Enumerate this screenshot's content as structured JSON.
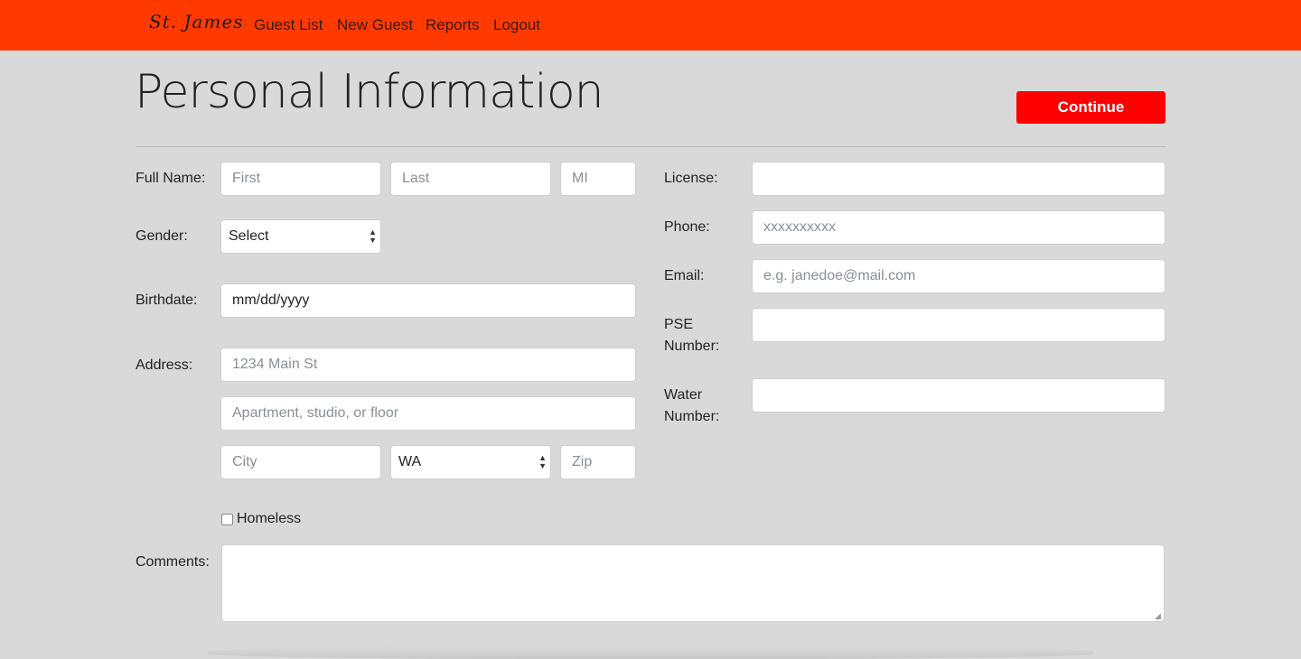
{
  "nav": {
    "brand": "St. James",
    "links": [
      "Guest List",
      "New Guest",
      "Reports",
      "Logout"
    ]
  },
  "page": {
    "title": "Personal Information",
    "continue_label": "Continue"
  },
  "form": {
    "full_name": {
      "label": "Full Name:",
      "first_placeholder": "First",
      "last_placeholder": "Last",
      "mi_placeholder": "MI"
    },
    "gender": {
      "label": "Gender:",
      "value": "Select"
    },
    "birthdate": {
      "label": "Birthdate:",
      "value": "mm/dd/yyyy"
    },
    "address": {
      "label": "Address:",
      "line1_placeholder": "1234 Main St",
      "line2_placeholder": "Apartment, studio, or floor",
      "city_placeholder": "City",
      "state_value": "WA",
      "zip_placeholder": "Zip"
    },
    "homeless": {
      "label": "Homeless",
      "checked": false
    },
    "comments": {
      "label": "Comments:",
      "value": ""
    },
    "license": {
      "label": "License:",
      "value": ""
    },
    "phone": {
      "label": "Phone:",
      "placeholder": "xxxxxxxxxx"
    },
    "email": {
      "label": "Email:",
      "placeholder": "e.g. janedoe@mail.com"
    },
    "pse": {
      "label_line1": "PSE",
      "label_line2": "Number:",
      "value": ""
    },
    "water": {
      "label_line1": "Water",
      "label_line2": "Number:",
      "value": ""
    }
  },
  "colors": {
    "navbar": "#ff3a00",
    "continue_button": "#ff0000",
    "page_background": "#d9d9d9"
  }
}
